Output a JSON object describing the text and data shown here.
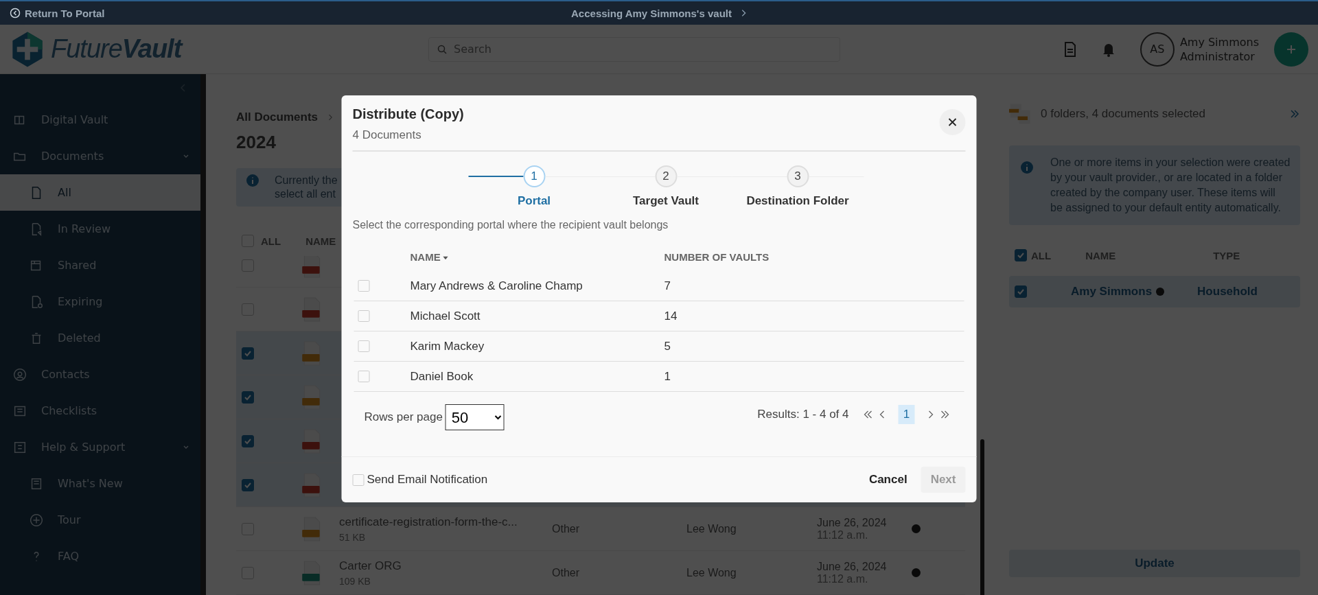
{
  "topbar": {
    "return_link": "Return To Portal",
    "vault_notice": "Accessing Amy Simmons's vault"
  },
  "header": {
    "logo": "Future**Vault**",
    "search": {
      "placeholder": "Search"
    },
    "user": {
      "initials": "AS",
      "name": "Amy Simmons",
      "role": "Administrator"
    }
  },
  "sidebar": {
    "items": [
      {
        "label": "Digital Vault",
        "kind": "vault",
        "selected": false
      },
      {
        "label": "Documents",
        "kind": "folder",
        "selected": false,
        "expanded": true,
        "children": [
          {
            "label": "All",
            "kind": "file",
            "selected": true
          },
          {
            "label": "In Review",
            "kind": "review",
            "selected": false
          },
          {
            "label": "Shared",
            "kind": "shared",
            "selected": false
          },
          {
            "label": "Expiring",
            "kind": "expiring",
            "selected": false
          },
          {
            "label": "Deleted",
            "kind": "trash",
            "selected": false
          }
        ]
      },
      {
        "label": "Contacts",
        "kind": "contacts",
        "selected": false
      },
      {
        "label": "Checklists",
        "kind": "checklist",
        "selected": false
      },
      {
        "label": "Help & Support",
        "kind": "help",
        "selected": false,
        "expanded": true,
        "children": [
          {
            "label": "What's New",
            "kind": "news",
            "selected": false
          },
          {
            "label": "Tour",
            "kind": "tour",
            "selected": false
          },
          {
            "label": "FAQ",
            "kind": "faq",
            "selected": false
          }
        ]
      }
    ]
  },
  "main": {
    "breadcrumb": "All Documents",
    "year": "2024",
    "banner": [
      "Currently the",
      "select all ent"
    ],
    "table": {
      "all_label": "ALL",
      "all_checked": false,
      "name_label": "NAME",
      "hidden_rows": [
        {
          "checked": false,
          "kind": "pdf"
        },
        {
          "checked": false,
          "kind": "pdf"
        },
        {
          "checked": true,
          "kind": "doc"
        },
        {
          "checked": true,
          "kind": "doc"
        },
        {
          "checked": true,
          "kind": "pdf"
        },
        {
          "checked": true,
          "kind": "pdf"
        }
      ],
      "rows": [
        {
          "name": "certificate-registration-form-the-c...",
          "size": "51 KB",
          "type": "Other",
          "owner": "Lee Wong",
          "date": "June 26, 2024",
          "time": "11:12 a.m.",
          "checked": false,
          "kind": "doc"
        },
        {
          "name": "Carter ORG",
          "size": "109 KB",
          "type": "Other",
          "owner": "Lee Wong",
          "date": "June 26, 2024",
          "time": "11:12 a.m.",
          "checked": false,
          "kind": "image"
        }
      ]
    }
  },
  "panel": {
    "summary": "0 folders, 4 documents selected",
    "notice": "One or more items in your selection were created by your vault provider., or are located in a folder created by the company user. These items will be assigned to your default entity automatically.",
    "all_label": "ALL",
    "all_checked": true,
    "name_label": "NAME",
    "type_label": "TYPE",
    "rows": [
      {
        "name": "Amy Simmons",
        "type": "Household",
        "checked": true
      }
    ],
    "update_button": "Update"
  },
  "modal": {
    "title": "Distribute (Copy)",
    "subtitle": "4 Documents",
    "steps": [
      {
        "number": "1",
        "label": "Portal",
        "selected": true
      },
      {
        "number": "2",
        "label": "Target Vault",
        "selected": false
      },
      {
        "number": "3",
        "label": "Destination Folder",
        "selected": false
      }
    ],
    "instruction": "Select the corresponding portal where the recipient vault belongs",
    "columns": [
      "NAME",
      "NUMBER OF VAULTS"
    ],
    "rows": [
      {
        "name": "Mary Andrews & Caroline Champ",
        "vaults": "7",
        "checked": false
      },
      {
        "name": "Michael Scott",
        "vaults": "14",
        "checked": false
      },
      {
        "name": "Karim Mackey",
        "vaults": "5",
        "checked": false
      },
      {
        "name": "Daniel Book",
        "vaults": "1",
        "checked": false
      }
    ],
    "rows_per_page_label": "Rows per page",
    "rows_per_page": "50",
    "results": "Results: 1 - 4 of 4",
    "pages": [
      {
        "label": "1",
        "selected": true
      }
    ],
    "notify": {
      "label": "Send Email Notification",
      "checked": false
    },
    "cancel": "Cancel",
    "next": {
      "label": "Next",
      "disabled": true
    }
  }
}
